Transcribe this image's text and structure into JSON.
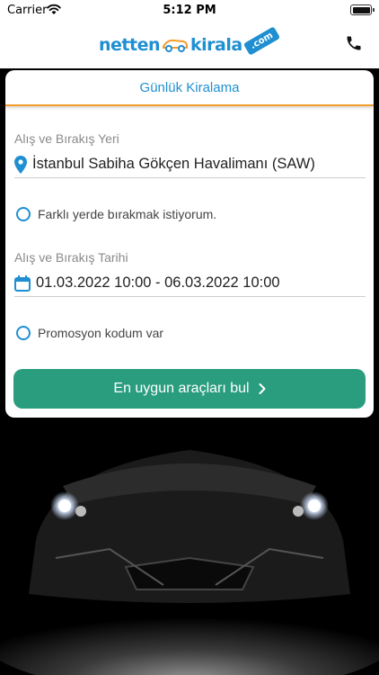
{
  "status_bar": {
    "carrier": "Carrier",
    "time": "5:12 PM"
  },
  "header": {
    "logo_part1": "netten",
    "logo_part2": "kirala",
    "logo_tag": ".com",
    "phone_icon": "phone-icon",
    "brand_color": "#1f8fd1"
  },
  "tab": {
    "title": "Günlük Kiralama",
    "underline_color": "#f39c2a"
  },
  "form": {
    "location_label": "Alış ve Bırakış Yeri",
    "location_icon": "map-pin-icon",
    "location_value": "İstanbul Sabiha Gökçen Havalimanı (SAW)",
    "different_return_label": "Farklı yerde bırakmak istiyorum.",
    "different_return_checked": false,
    "date_label": "Alış ve Bırakış Tarihi",
    "date_icon": "calendar-icon",
    "date_value": "01.03.2022 10:00 - 06.03.2022 10:00",
    "promo_label": "Promosyon kodum var",
    "promo_checked": false
  },
  "search_button": {
    "label": "En uygun araçları bul",
    "icon": "chevron-right-icon",
    "color": "#2a9d7f"
  }
}
